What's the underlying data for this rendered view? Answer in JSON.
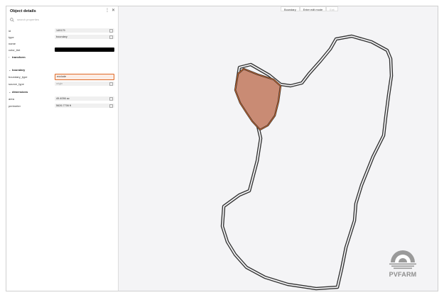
{
  "panel": {
    "title": "Object details",
    "more_icon": "more-vertical-icon",
    "close_icon": "close-icon",
    "search_placeholder": "search properties",
    "rows": {
      "id": {
        "label": "id",
        "value": "149179"
      },
      "type": {
        "label": "type",
        "value": "boundary"
      },
      "name": {
        "label": "name",
        "value": ""
      },
      "color_tint": {
        "label": "color_tint",
        "value": "#000000"
      }
    },
    "sections": {
      "transform": {
        "label": "transform",
        "expanded": false
      },
      "boundary": {
        "label": "boundary",
        "expanded": true
      },
      "dimensions": {
        "label": "dimensions",
        "expanded": true
      }
    },
    "boundary_rows": {
      "boundary_type": {
        "label": "boundary_type",
        "value": "exclude"
      },
      "source_type": {
        "label": "source_type",
        "value": "origin"
      }
    },
    "dimension_rows": {
      "area": {
        "label": "area",
        "value": "49.4056 ac"
      },
      "perimeter": {
        "label": "perimeter",
        "value": "5626.7706 ft"
      }
    }
  },
  "toolbar": {
    "boundary_label": "Boundary",
    "edit_mode_label": "Enter edit mode",
    "exit_label": "Exit"
  },
  "colors": {
    "accent": "#e06a25",
    "exclusion_fill": "#c98b74",
    "outline": "#333333",
    "canvas": "#f4f4f6"
  },
  "brand": {
    "logo_text": "PVFARM"
  }
}
